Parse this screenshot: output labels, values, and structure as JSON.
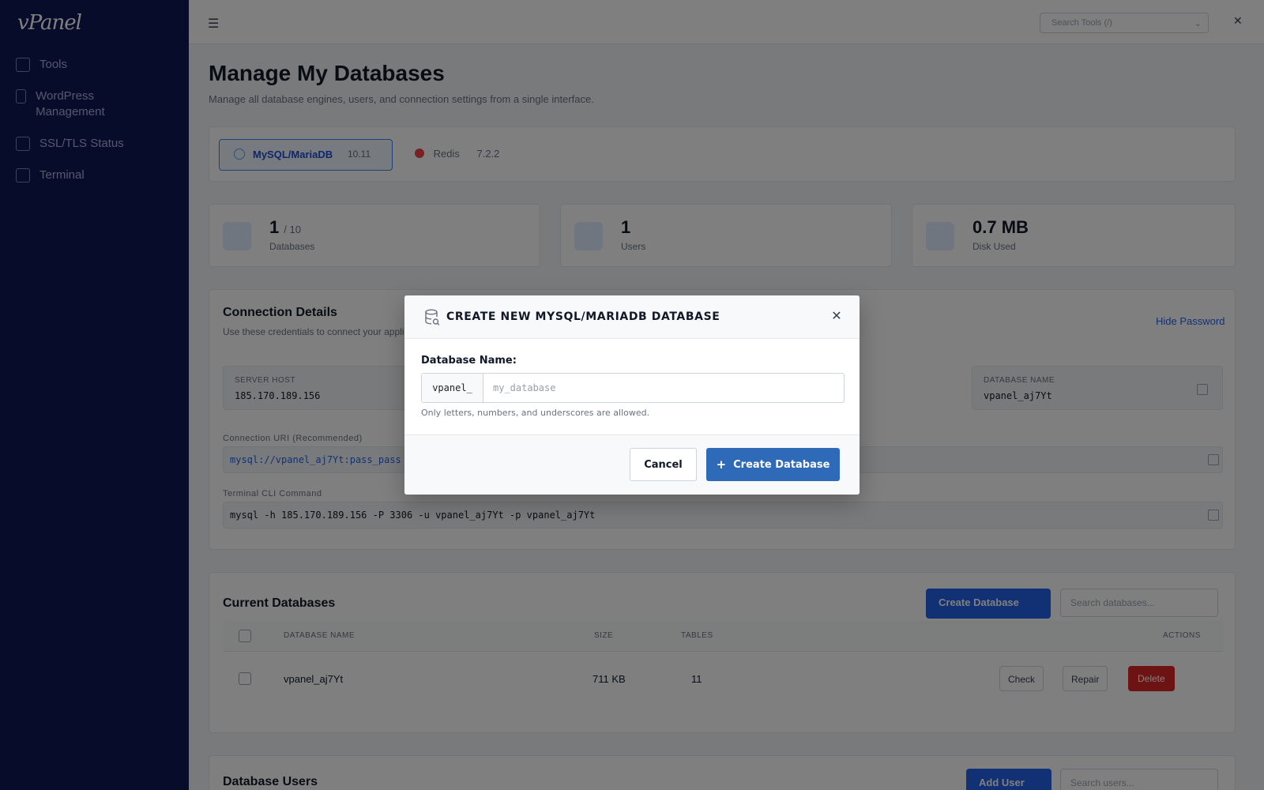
{
  "sidebar": {
    "logo": "vPanel",
    "items": [
      {
        "label": "Tools",
        "icon": "wrench-icon"
      },
      {
        "label": "WordPress Management",
        "icon": "wordpress-icon"
      },
      {
        "label": "SSL/TLS Status",
        "icon": "lock-icon"
      },
      {
        "label": "Terminal",
        "icon": "terminal-icon"
      }
    ]
  },
  "topbar": {
    "search_placeholder": "Search Tools (/)"
  },
  "page": {
    "title": "Manage My Databases",
    "subtitle": "Manage all database engines, users, and connection settings from a single interface."
  },
  "engines": [
    {
      "label": "MySQL/MariaDB",
      "version": "10.11"
    },
    {
      "label": "Redis",
      "version": "7.2.2"
    }
  ],
  "stats": [
    {
      "value": "1",
      "suffix": "/ 10",
      "label": "Databases"
    },
    {
      "value": "1",
      "suffix": "",
      "label": "Users"
    },
    {
      "value": "0.7 MB",
      "suffix": "",
      "label": "Disk Used"
    }
  ],
  "connection": {
    "title": "Connection Details",
    "subtitle": "Use these credentials to connect your applications.",
    "hide_password": "Hide Password",
    "server_host_label": "SERVER HOST",
    "server_host": "185.170.189.156",
    "db_name_label": "DATABASE NAME",
    "db_name": "vpanel_aj7Yt",
    "uri_label": "Connection URI (Recommended)",
    "uri": "mysql://vpanel_aj7Yt:pass_pass",
    "terminal_label": "Terminal CLI Command",
    "terminal_cmd": "mysql -h 185.170.189.156 -P 3306 -u vpanel_aj7Yt -p vpanel_aj7Yt"
  },
  "current_dbs": {
    "title": "Current Databases",
    "create_button": "Create Database",
    "search_placeholder": "Search databases...",
    "columns": [
      "DATABASE NAME",
      "SIZE",
      "TABLES",
      "ACTIONS"
    ],
    "rows": [
      {
        "name": "vpanel_aj7Yt",
        "size": "711 KB",
        "tables": "11"
      }
    ],
    "actions": {
      "check": "Check",
      "repair": "Repair",
      "delete": "Delete"
    }
  },
  "db_users": {
    "title": "Database Users",
    "add_button": "Add User",
    "search_placeholder": "Search users..."
  },
  "modal": {
    "title": "CREATE NEW MYSQL/MARIADB DATABASE",
    "icon": "database-icon",
    "field_label": "Database Name:",
    "prefix": "vpanel_",
    "placeholder": "my_database",
    "value": "",
    "help": "Only letters, numbers, and underscores are allowed.",
    "cancel_label": "Cancel",
    "create_label": "Create Database",
    "close_icon": "close-icon"
  },
  "colors": {
    "sidebar_bg": "#101957",
    "primary": "#2f6ab8",
    "danger": "#dc2626",
    "overlay": "rgba(0,0,0,0.5)"
  }
}
